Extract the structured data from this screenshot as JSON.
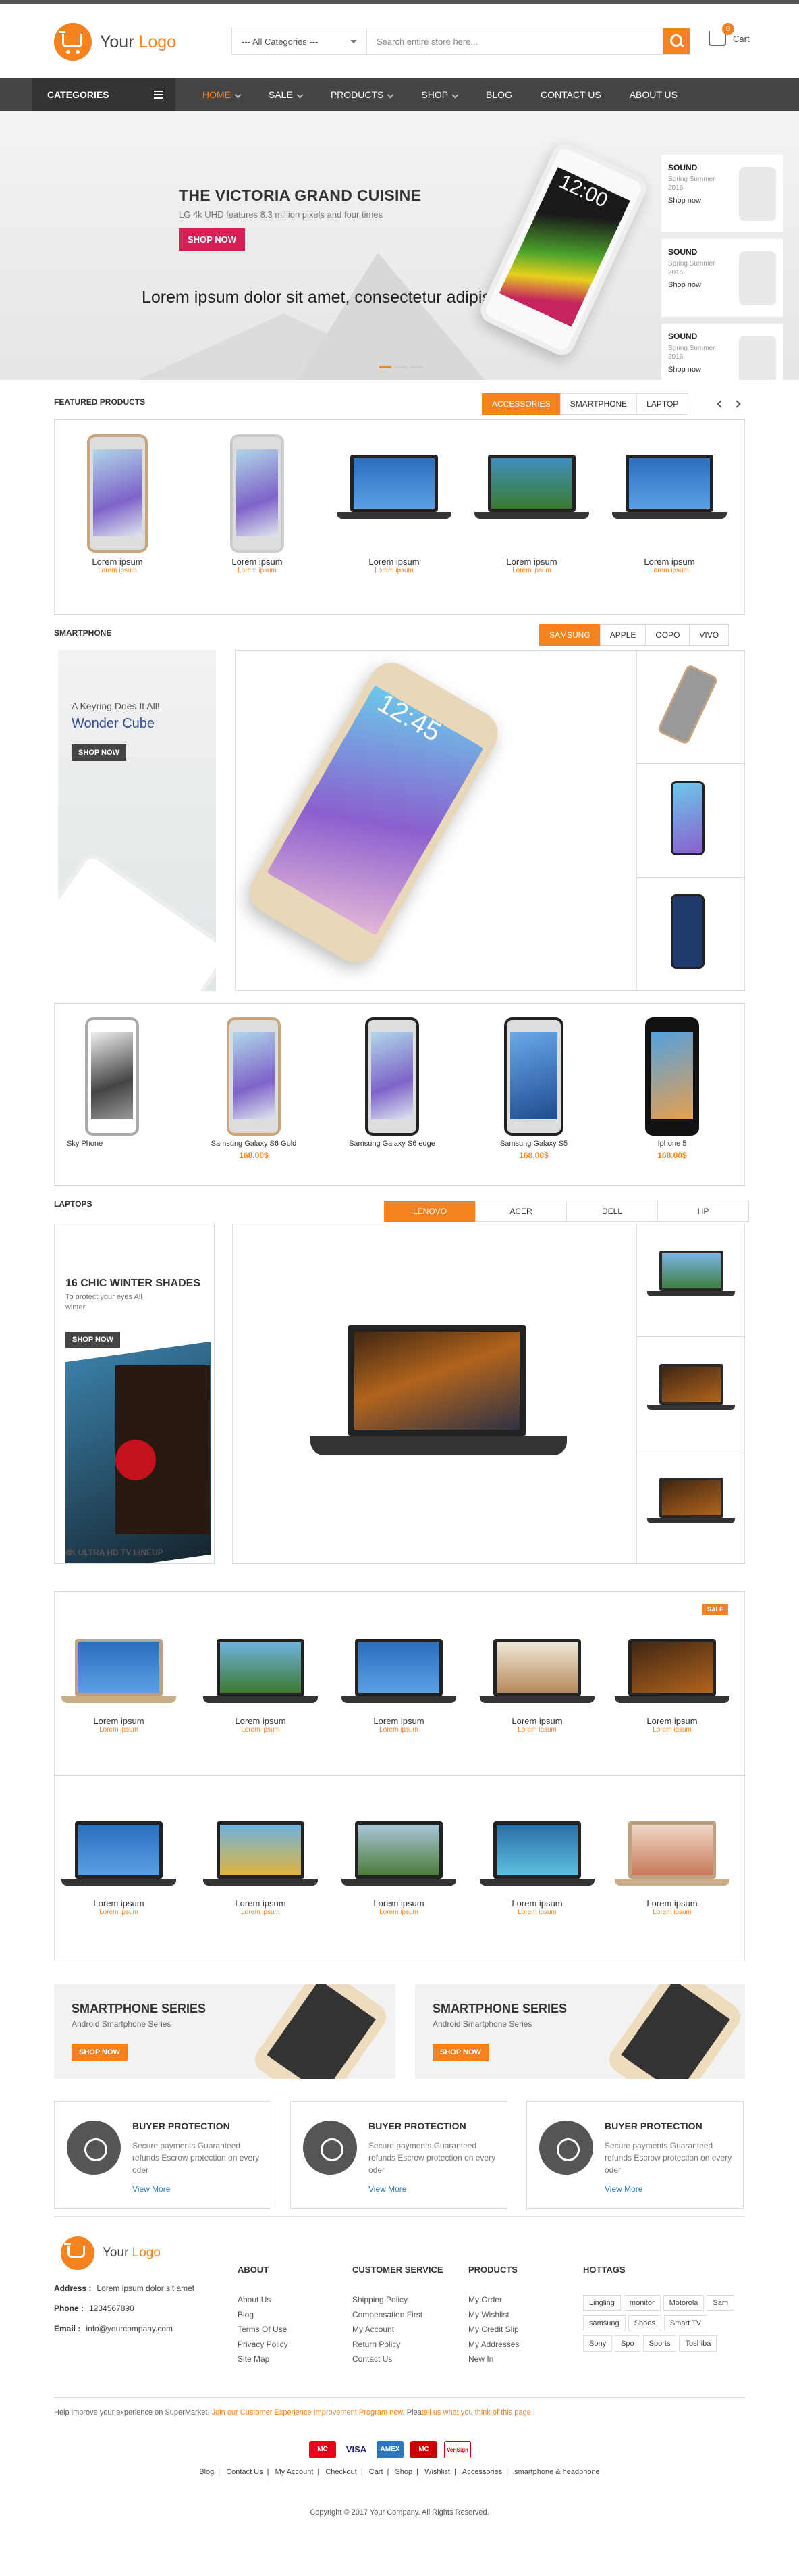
{
  "header": {
    "logo_text": "Your",
    "logo_accent": "Logo",
    "search_category": "--- All Categories ---",
    "search_placeholder": "Search entire store here...",
    "cart_count": "0",
    "cart_label": "Cart"
  },
  "nav": {
    "categories_label": "CATEGORIES",
    "items": [
      "HOME",
      "SALE",
      "PRODUCTS",
      "SHOP",
      "BLOG",
      "CONTACT US",
      "ABOUT US"
    ]
  },
  "hero": {
    "title": "THE VICTORIA GRAND CUISINE",
    "subtitle": "LG 4k UHD features 8.3 million pixels and four times",
    "button": "SHOP NOW",
    "caption": "Lorem ipsum dolor sit amet, consectetur adipiscing elit",
    "phone_time": "12:00",
    "ads": [
      {
        "title": "SOUND",
        "text": "Spring Summer 2016",
        "link": "Shop now"
      },
      {
        "title": "SOUND",
        "text": "Spring Summer 2016",
        "link": "Shop now"
      },
      {
        "title": "SOUND",
        "text": "Spring Summer 2016",
        "link": "Shop now"
      }
    ]
  },
  "featured": {
    "title": "FEATURED PRODUCTS",
    "tabs": [
      "ACCESSORIES",
      "SMARTPHONE",
      "LAPTOP"
    ],
    "products": [
      {
        "name": "Lorem ipsum",
        "price": "Lorem ipsum"
      },
      {
        "name": "Lorem ipsum",
        "price": "Lorem ipsum"
      },
      {
        "name": "Lorem ipsum",
        "price": "Lorem ipsum"
      },
      {
        "name": "Lorem ipsum",
        "price": "Lorem ipsum"
      },
      {
        "name": "Lorem ipsum",
        "price": "Lorem ipsum"
      }
    ]
  },
  "smartphone": {
    "title": "SMARTPHONE",
    "tabs": [
      "SAMSUNG",
      "APPLE",
      "OOPO",
      "VIVO"
    ],
    "banner_pre": "A Keyring Does It All!",
    "banner_title": "Wonder Cube",
    "banner_btn": "SHOP NOW",
    "big_time": "12:45",
    "products": [
      {
        "name": "Sky Phone",
        "price": ""
      },
      {
        "name": "Samsung Galaxy S6 Gold",
        "price": "168.00$"
      },
      {
        "name": "Samsung Galaxy S6 edge",
        "price": ""
      },
      {
        "name": "Samsung Galaxy S5",
        "price": "168.00$"
      },
      {
        "name": "Iphone 5",
        "price": "168.00$"
      }
    ]
  },
  "laptops": {
    "title": "LAPTOPS",
    "tabs": [
      "LENOVO",
      "ACER",
      "DELL",
      "HP"
    ],
    "banner_title": "16 CHIC WINTER SHADES",
    "banner_text": "To protect your eyes All winter",
    "banner_btn": "SHOP NOW",
    "banner_caption": "4K ULTRA HD TV LINEUP"
  },
  "grid": {
    "sale_tag": "SALE",
    "row1": [
      {
        "name": "Lorem ipsum",
        "price": "Lorem ipsum"
      },
      {
        "name": "Lorem ipsum",
        "price": "Lorem ipsum"
      },
      {
        "name": "Lorem ipsum",
        "price": "Lorem ipsum"
      },
      {
        "name": "Lorem ipsum",
        "price": "Lorem ipsum"
      },
      {
        "name": "Lorem ipsum",
        "price": "Lorem ipsum"
      }
    ],
    "row2": [
      {
        "name": "Lorem ipsum",
        "price": "Lorem ipsum"
      },
      {
        "name": "Lorem ipsum",
        "price": "Lorem ipsum"
      },
      {
        "name": "Lorem ipsum",
        "price": "Lorem ipsum"
      },
      {
        "name": "Lorem ipsum",
        "price": "Lorem ipsum"
      },
      {
        "name": "Lorem ipsum",
        "price": "Lorem ipsum"
      }
    ]
  },
  "promos": [
    {
      "title": "SMARTPHONE SERIES",
      "text": "Android Smartphone Series",
      "btn": "SHOP NOW"
    },
    {
      "title": "SMARTPHONE SERIES",
      "text": "Android Smartphone Series",
      "btn": "SHOP NOW"
    }
  ],
  "features": [
    {
      "title": "BUYER PROTECTION",
      "text": "Secure payments Guaranteed refunds Escrow protection on every oder",
      "more": "View More"
    },
    {
      "title": "BUYER PROTECTION",
      "text": "Secure payments Guaranteed refunds Escrow protection on every oder",
      "more": "View More"
    },
    {
      "title": "BUYER PROTECTION",
      "text": "Secure payments Guaranteed refunds Escrow protection on every oder",
      "more": "View More"
    }
  ],
  "footer": {
    "address_label": "Address :",
    "address": "Lorem ipsum dolor sit amet",
    "phone_label": "Phone :",
    "phone": "1234567890",
    "email_label": "Email :",
    "email": "info@yourcompany.com",
    "about": {
      "title": "ABOUT",
      "items": [
        "About Us",
        "Blog",
        "Terms Of Use",
        "Privacy Policy",
        "Site Map"
      ]
    },
    "service": {
      "title": "CUSTOMER SERVICE",
      "items": [
        "Shipping Policy",
        "Compensation First",
        "My Account",
        "Return Policy",
        "Contact Us"
      ]
    },
    "products": {
      "title": "PRODUCTS",
      "items": [
        "My Order",
        "My Wishlist",
        "My Credit Slip",
        "My Addresses",
        "New In"
      ]
    },
    "hottags": {
      "title": "HOTTAGS",
      "items": [
        "Lingling",
        "monitor",
        "Motorola",
        "Sam",
        "samsung",
        "Shoes",
        "Smart TV",
        "Sony",
        "Spo",
        "Sports",
        "Toshiba"
      ]
    },
    "msg_pre": "Help improve your experience on SuperMarket.",
    "msg_link": "Join our Customer Experience Improvement Program now.",
    "msg_post": "Plea",
    "msg_link2": "tell us what you think of this page !",
    "payments": [
      "MC",
      "VISA",
      "AMEX",
      "MC",
      "VeriSign"
    ],
    "links": [
      "Blog",
      "Contact Us",
      "My Account",
      "Checkout",
      "Cart",
      "Shop",
      "Wishlist",
      "Accessories",
      "smartphone & headphone"
    ],
    "copyright": "Copyright © 2017 Your Company. All Rights Reserved."
  }
}
